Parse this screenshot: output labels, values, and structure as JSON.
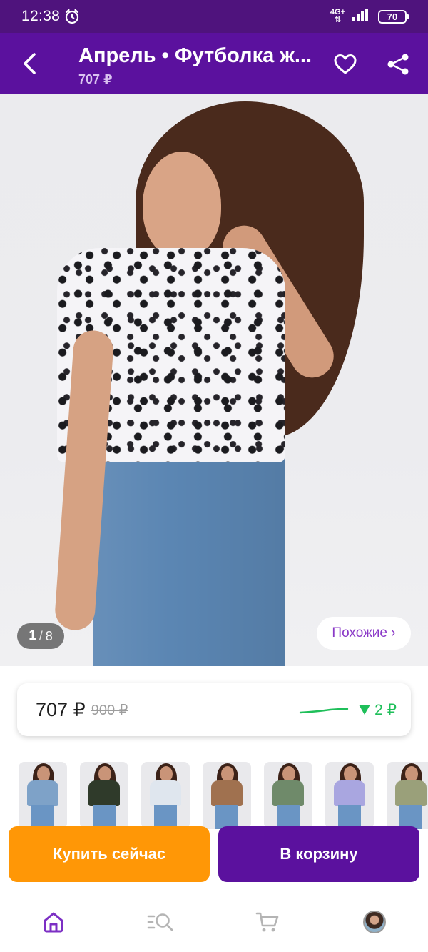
{
  "status_bar": {
    "time": "12:38",
    "network_top": "4G+",
    "network_bottom": "⇅",
    "battery": "70"
  },
  "header": {
    "title": "Апрель • Футболка ж...",
    "price": "707 ₽"
  },
  "gallery": {
    "current": "1",
    "separator": "/",
    "total": "8",
    "similar_label": "Похожие ›"
  },
  "price_card": {
    "current_price": "707 ₽",
    "old_price": "900 ₽",
    "trend_value": "2 ₽",
    "trend_color": "#1fbf5a"
  },
  "variants": [
    {
      "shirt_color": "#7ea2c8"
    },
    {
      "shirt_color": "#2f3a2a"
    },
    {
      "shirt_color": "#dfe6ee"
    },
    {
      "shirt_color": "#a0714f"
    },
    {
      "shirt_color": "#6f8a6a"
    },
    {
      "shirt_color": "#a9a6e0"
    },
    {
      "shirt_color": "#9aa07a"
    }
  ],
  "actions": {
    "buy_now": "Купить сейчас",
    "add_to_cart": "В корзину"
  },
  "bottom_nav": {
    "items": [
      {
        "icon": "home-icon",
        "active": true
      },
      {
        "icon": "catalog-search-icon",
        "active": false
      },
      {
        "icon": "cart-icon",
        "active": false
      },
      {
        "icon": "profile-avatar",
        "active": false
      }
    ]
  },
  "colors": {
    "status_bar": "#4f137d",
    "header": "#5b119e",
    "accent_orange": "#ff9706",
    "accent_purple": "#5b119e",
    "similar_text": "#8a39c7"
  }
}
